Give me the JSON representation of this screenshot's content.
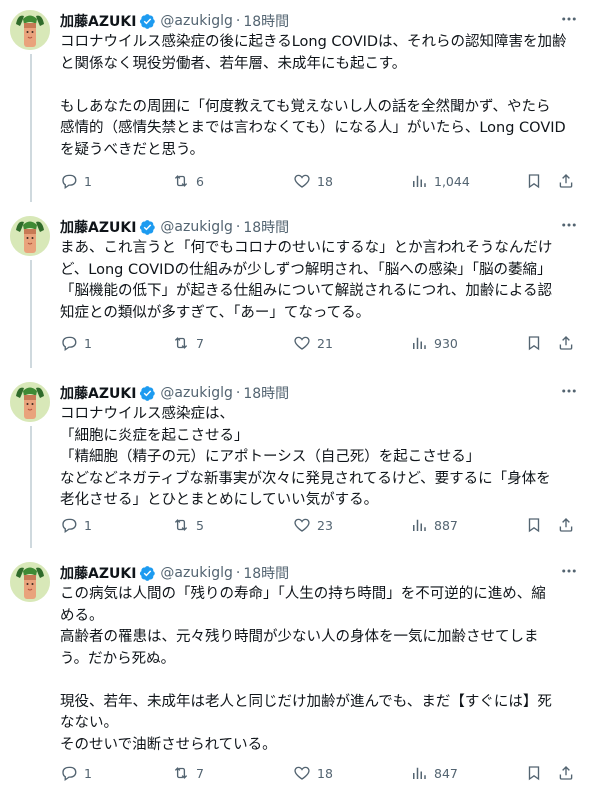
{
  "tweets": [
    {
      "author_name": "加藤AZUKI",
      "handle": "@azukiglg",
      "separator": "·",
      "time": "18時間",
      "text": "コロナウイルス感染症の後に起きるLong COVIDは、それらの認知障害を加齢\nと関係なく現役労働者、若年層、未成年にも起こす。\n\nもしあなたの周囲に「何度教えても覚えないし人の話を全然聞かず、やたら\n感情的（感情失禁とまでは言わなくても）になる人」がいたら、Long COVID\nを疑うべきだと思う。",
      "replies": "1",
      "reposts": "6",
      "likes": "18",
      "views": "1,044"
    },
    {
      "author_name": "加藤AZUKI",
      "handle": "@azukiglg",
      "separator": "·",
      "time": "18時間",
      "text": "まあ、これ言うと「何でもコロナのせいにするな」とか言われそうなんだけ\nど、Long COVIDの仕組みが少しずつ解明され、「脳への感染」「脳の萎縮」\n「脳機能の低下」が起きる仕組みについて解説されるにつれ、加齢による認\n知症との類似が多すぎて、「あー」てなってる。",
      "replies": "1",
      "reposts": "7",
      "likes": "21",
      "views": "930"
    },
    {
      "author_name": "加藤AZUKI",
      "handle": "@azukiglg",
      "separator": "·",
      "time": "18時間",
      "text": "コロナウイルス感染症は、\n「細胞に炎症を起こさせる」\n「精細胞（精子の元）にアポトーシス（自己死）を起こさせる」\nなどなどネガティブな新事実が次々に発見されてるけど、要するに「身体を\n老化させる」とひとまとめにしていい気がする。",
      "replies": "1",
      "reposts": "5",
      "likes": "23",
      "views": "887"
    },
    {
      "author_name": "加藤AZUKI",
      "handle": "@azukiglg",
      "separator": "·",
      "time": "18時間",
      "text": "この病気は人間の「残りの寿命」「人生の持ち時間」を不可逆的に進め、縮\nめる。\n高齢者の罹患は、元々残り時間が少ない人の身体を一気に加齢させてしま\nう。だから死ぬ。\n\n現役、若年、未成年は老人と同じだけ加齢が進んでも、まだ【すぐには】死\nなない。\nそのせいで油断させられている。",
      "replies": "1",
      "reposts": "7",
      "likes": "18",
      "views": "847"
    }
  ],
  "colors": {
    "text": "#0f1419",
    "secondary": "#536471",
    "verified": "#1d9bf0",
    "thread_line": "#cfd9de"
  },
  "icons": [
    "reply-icon",
    "repost-icon",
    "like-icon",
    "views-icon",
    "bookmark-icon",
    "share-icon",
    "more-icon",
    "verified-badge-icon"
  ]
}
